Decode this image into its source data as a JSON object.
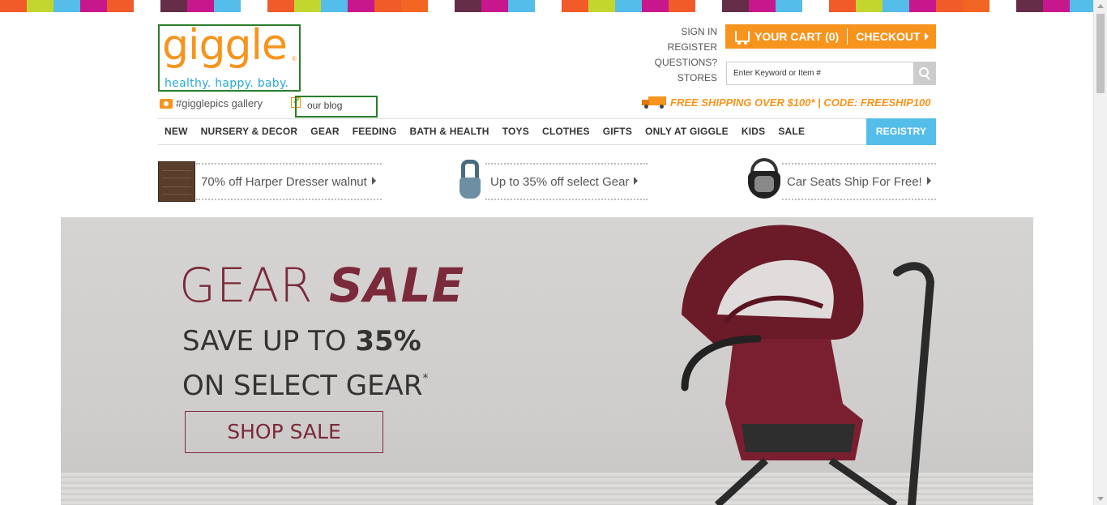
{
  "colors": {
    "brand_orange": "#f7941d",
    "brand_blue": "#29a9d4",
    "registry_blue": "#54bde9",
    "hero_maroon": "#7b2a3b",
    "strip": [
      "#f15a29",
      "#c2d62e",
      "#54bde9",
      "#c8168d",
      "#f15a29",
      "#ffffff",
      "#662d49",
      "#c8168d",
      "#54bde9",
      "#ffffff",
      "#f15a29",
      "#c2d62e",
      "#54bde9",
      "#c8168d",
      "#f15a29",
      "#f26522",
      "#ffffff",
      "#662d49",
      "#c8168d",
      "#54bde9",
      "#ffffff",
      "#f15a29",
      "#c2d62e",
      "#54bde9",
      "#c8168d",
      "#f15a29",
      "#ffffff",
      "#662d49",
      "#c8168d",
      "#54bde9",
      "#ffffff",
      "#f15a29",
      "#c2d62e",
      "#54bde9",
      "#c8168d",
      "#f15a29",
      "#f26522",
      "#ffffff",
      "#662d49",
      "#c8168d",
      "#54bde9"
    ]
  },
  "logo": {
    "word": "giggle",
    "reg": "®",
    "tagline": "healthy. happy. baby."
  },
  "sublinks": {
    "gallery": "#gigglepics gallery",
    "blog": "our blog"
  },
  "account": {
    "sign_in": "SIGN IN",
    "register": "REGISTER",
    "questions": "QUESTIONS?",
    "stores": "STORES"
  },
  "cart": {
    "label": "YOUR CART (0)",
    "checkout": "CHECKOUT"
  },
  "search": {
    "placeholder": "Enter Keyword or Item #"
  },
  "shipping": {
    "text": "FREE SHIPPING OVER $100* | CODE: FREESHIP100"
  },
  "nav": {
    "items": [
      "NEW",
      "NURSERY & DECOR",
      "GEAR",
      "FEEDING",
      "BATH & HEALTH",
      "TOYS",
      "CLOTHES",
      "GIFTS",
      "ONLY AT GIGGLE",
      "KIDS",
      "SALE"
    ],
    "registry": "REGISTRY"
  },
  "promos": [
    {
      "text": "70% off Harper Dresser walnut",
      "icon": "dresser-icon"
    },
    {
      "text": "Up to 35% off select Gear",
      "icon": "baby-carrier-icon"
    },
    {
      "text": "Car Seats Ship For Free!",
      "icon": "car-seat-icon"
    }
  ],
  "hero": {
    "title_light": "GEAR ",
    "title_bold": "SALE",
    "line1_light": "SAVE UP TO ",
    "line1_bold": "35%",
    "line2": "ON SELECT GEAR",
    "line2_sup": "*",
    "button": "SHOP SALE"
  }
}
